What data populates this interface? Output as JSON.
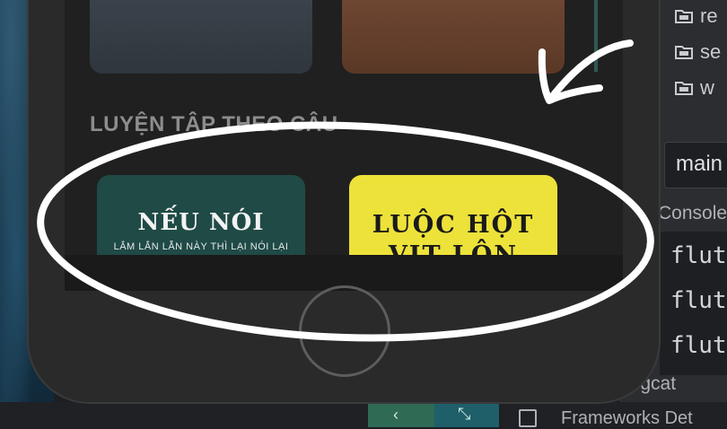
{
  "ide": {
    "tree_items": [
      "re",
      "se",
      "w"
    ],
    "run_config": "main",
    "console_tab": "Console",
    "console_lines": [
      "flut",
      "flut",
      "flut"
    ],
    "logcat_label": "Logcat",
    "frameworks_label": "Frameworks Det"
  },
  "app": {
    "section_title": "LUYỆN TẬP THEO CÂU",
    "cards": [
      {
        "title": "NẾU NÓI",
        "subtitle": "LẮM LẮN LẪN NÀY THÌ LẠI NÓI LẠI"
      },
      {
        "title": "LUỘC HỘT",
        "title_line2": "VỊT LỘN"
      }
    ]
  },
  "colors": {
    "annotation": "#ffffff",
    "card_dark": "#1f4a46",
    "card_yellow": "#ede23a"
  }
}
